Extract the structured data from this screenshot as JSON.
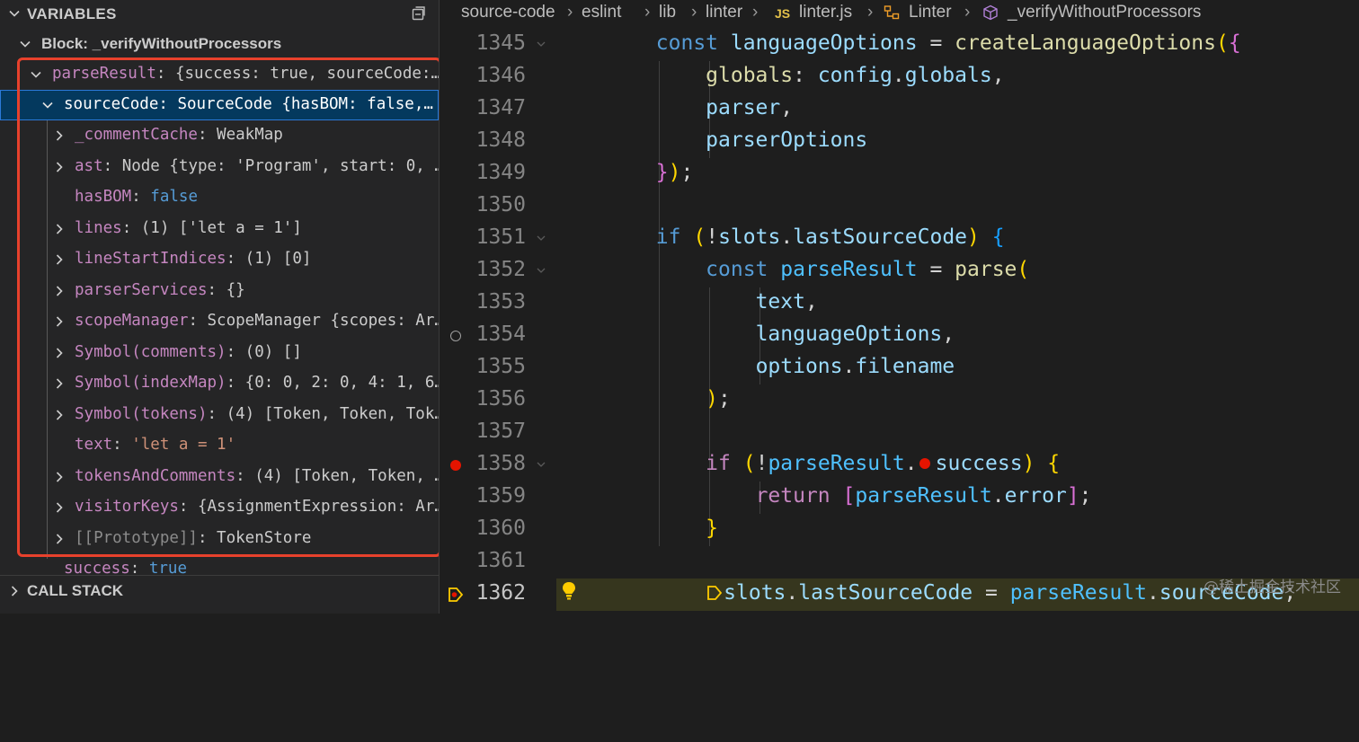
{
  "variables": {
    "title": "VARIABLES",
    "block_label": "Block: _verifyWithoutProcessors",
    "items": [
      {
        "key": "parseResult",
        "value": "{success: true, sourceCode:…"
      },
      {
        "key": "sourceCode",
        "value": "SourceCode {hasBOM: false,…"
      },
      {
        "key": "_commentCache",
        "value": "WeakMap"
      },
      {
        "key": "ast",
        "value": "Node {type: 'Program', start: 0, …"
      },
      {
        "key": "hasBOM",
        "value": "false"
      },
      {
        "key": "lines",
        "value": "(1) ['let a = 1']"
      },
      {
        "key": "lineStartIndices",
        "value": "(1) [0]"
      },
      {
        "key": "parserServices",
        "value": "{}"
      },
      {
        "key": "scopeManager",
        "value": "ScopeManager {scopes: Ar…"
      },
      {
        "key": "Symbol(comments)",
        "value": "(0) []"
      },
      {
        "key": "Symbol(indexMap)",
        "value": "{0: 0, 2: 0, 4: 1, 6…"
      },
      {
        "key": "Symbol(tokens)",
        "value": "(4) [Token, Token, Tok…"
      },
      {
        "key": "text",
        "value": "'let a = 1'"
      },
      {
        "key": "tokensAndComments",
        "value": "(4) [Token, Token, …"
      },
      {
        "key": "visitorKeys",
        "value": "{AssignmentExpression: Ar…"
      },
      {
        "key": "[[Prototype]]",
        "value": "TokenStore"
      },
      {
        "key": "success",
        "value": "true"
      }
    ]
  },
  "callstack": {
    "title": "CALL STACK"
  },
  "breadcrumbs": {
    "items": [
      "source-code",
      "eslint",
      "lib",
      "linter",
      "linter.js",
      "Linter",
      "_verifyWithoutProcessors"
    ],
    "js_badge": "JS"
  },
  "code": {
    "lines": [
      {
        "n": "1345"
      },
      {
        "n": "1346"
      },
      {
        "n": "1347"
      },
      {
        "n": "1348"
      },
      {
        "n": "1349"
      },
      {
        "n": "1350"
      },
      {
        "n": "1351"
      },
      {
        "n": "1352"
      },
      {
        "n": "1353"
      },
      {
        "n": "1354"
      },
      {
        "n": "1355"
      },
      {
        "n": "1356"
      },
      {
        "n": "1357"
      },
      {
        "n": "1358"
      },
      {
        "n": "1359"
      },
      {
        "n": "1360"
      },
      {
        "n": "1361"
      },
      {
        "n": "1362"
      }
    ],
    "t": {
      "const": "const",
      "languageOptions": "languageOptions",
      "eq": " = ",
      "createLanguageOptions": "createLanguageOptions",
      "globals": "globals",
      "colon": ": ",
      "config": "config",
      "globals2": "globals",
      "comma": ",",
      "parser": "parser",
      "parserOptions": "parserOptions",
      "if": "if",
      "slots": "slots",
      "lastSourceCode": "lastSourceCode",
      "parseResult": "parseResult",
      "parse": "parse",
      "text": "text",
      "options": "options",
      "filename": "filename",
      "success": "success",
      "return": "return",
      "error": "error",
      "sourceCode": "sourceCode"
    }
  },
  "watermark": "@稀土掘金技术社区",
  "colors": {
    "highlight_border": "#e8412c",
    "breakpoint": "#e51400",
    "selection": "#04395e"
  }
}
